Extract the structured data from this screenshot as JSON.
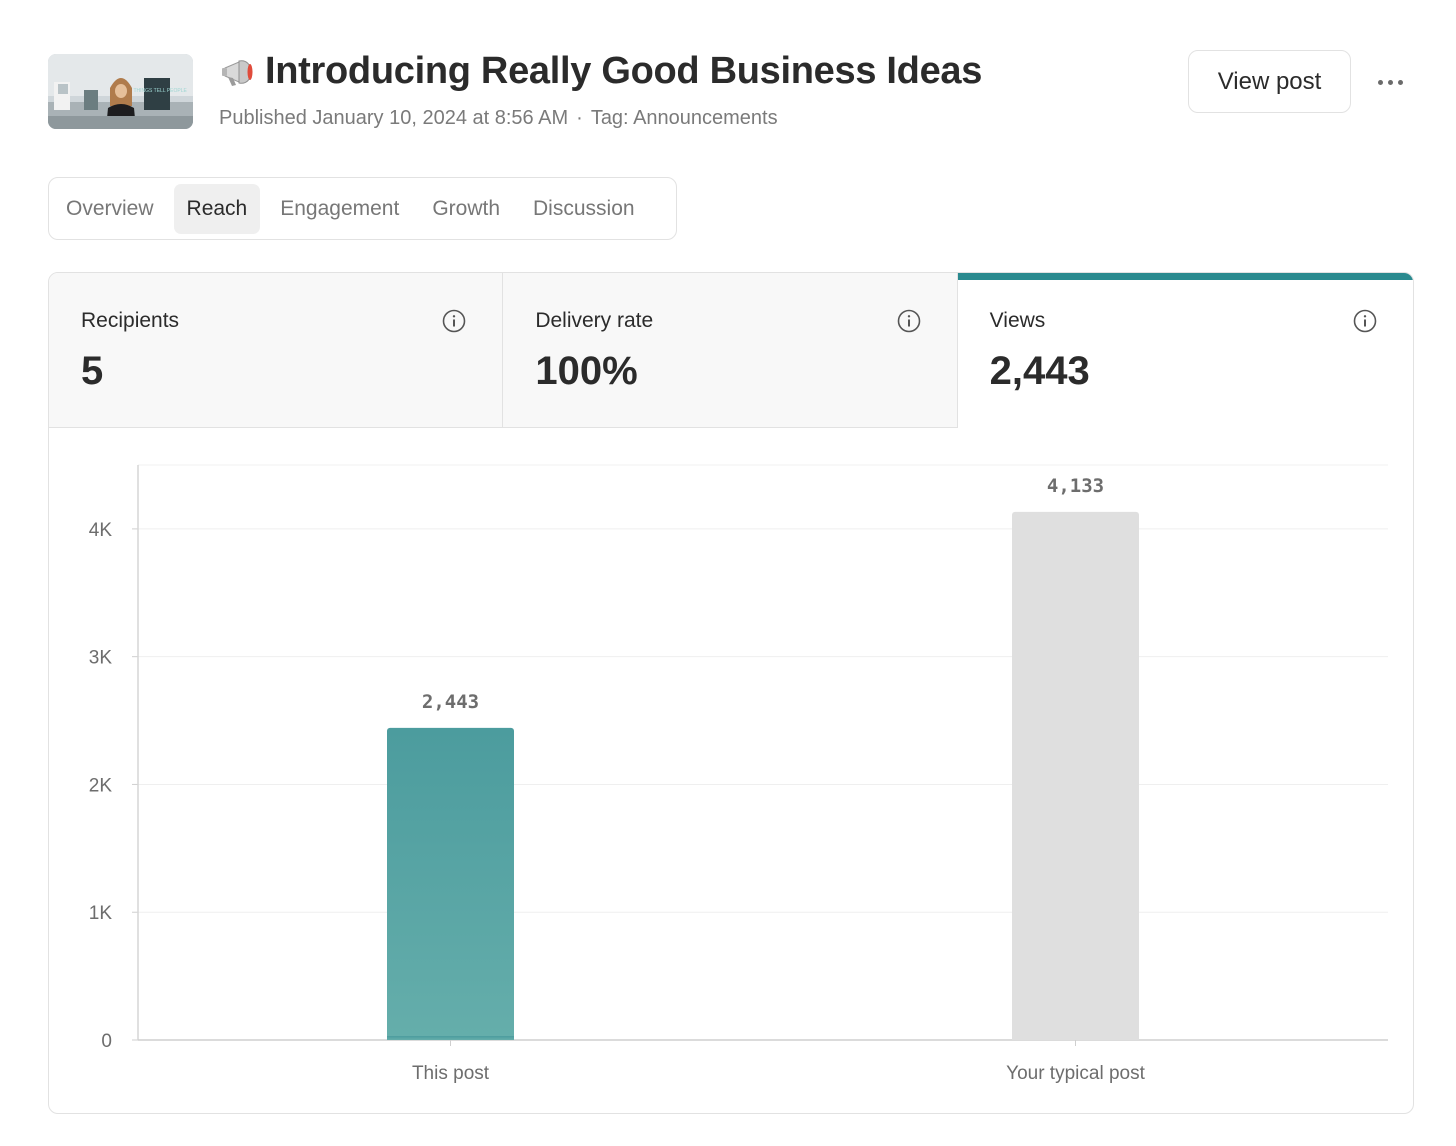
{
  "post": {
    "title": "Introducing Really Good Business Ideas",
    "title_icon": "megaphone-icon",
    "published": "Published January 10, 2024 at 8:56 AM",
    "separator": "·",
    "tag": "Tag: Announcements",
    "view_button": "View post",
    "thumbnail_sign": "IN THINGS TELL PEOPLE"
  },
  "tabs": [
    {
      "label": "Overview",
      "active": false
    },
    {
      "label": "Reach",
      "active": true
    },
    {
      "label": "Engagement",
      "active": false
    },
    {
      "label": "Growth",
      "active": false
    },
    {
      "label": "Discussion",
      "active": false
    }
  ],
  "stats": [
    {
      "label": "Recipients",
      "value": "5",
      "active": false
    },
    {
      "label": "Delivery rate",
      "value": "100%",
      "active": false
    },
    {
      "label": "Views",
      "value": "2,443",
      "active": true
    }
  ],
  "colors": {
    "accent": "#2a8a8f",
    "bar_this_post_top": "#4c9c9e",
    "bar_this_post_bottom": "#65aeab",
    "bar_typical": "#dfdfdf"
  },
  "chart_data": {
    "type": "bar",
    "categories": [
      "This post",
      "Your typical post"
    ],
    "values": [
      2443,
      4133
    ],
    "value_labels": [
      "2,443",
      "4,133"
    ],
    "ylim": [
      0,
      4500
    ],
    "yticks": [
      0,
      1000,
      2000,
      3000,
      4000
    ],
    "ytick_labels": [
      "0",
      "1K",
      "2K",
      "3K",
      "4K"
    ],
    "grid": true
  }
}
